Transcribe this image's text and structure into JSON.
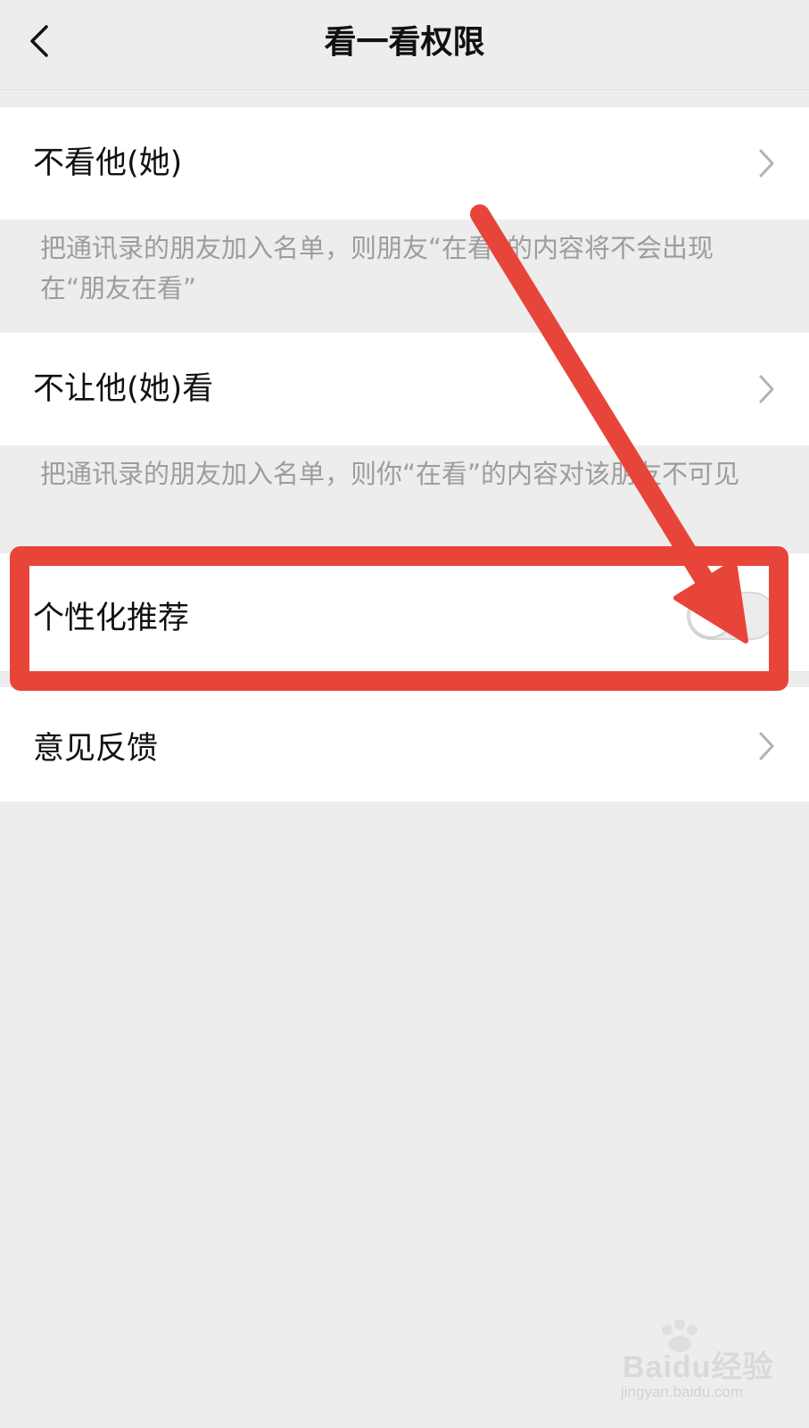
{
  "header": {
    "title": "看一看权限",
    "back_icon": "chevron-left-icon"
  },
  "items": [
    {
      "label": "不看他(她)",
      "description": "把通讯录的朋友加入名单，则朋友“在看”的内容将不会出现在“朋友在看”",
      "control": "chevron-right-icon"
    },
    {
      "label": "不让他(她)看",
      "description": "把通讯录的朋友加入名单，则你“在看”的内容对该朋友不可见",
      "control": "chevron-right-icon"
    },
    {
      "label": "个性化推荐",
      "control": "toggle-switch",
      "toggle_on": false
    },
    {
      "label": "意见反馈",
      "control": "chevron-right-icon"
    }
  ],
  "annotation": {
    "color": "#e8453a",
    "highlight": "个性化推荐"
  },
  "watermark": {
    "brand": "Baidu经验",
    "url": "jingyan.baidu.com"
  }
}
